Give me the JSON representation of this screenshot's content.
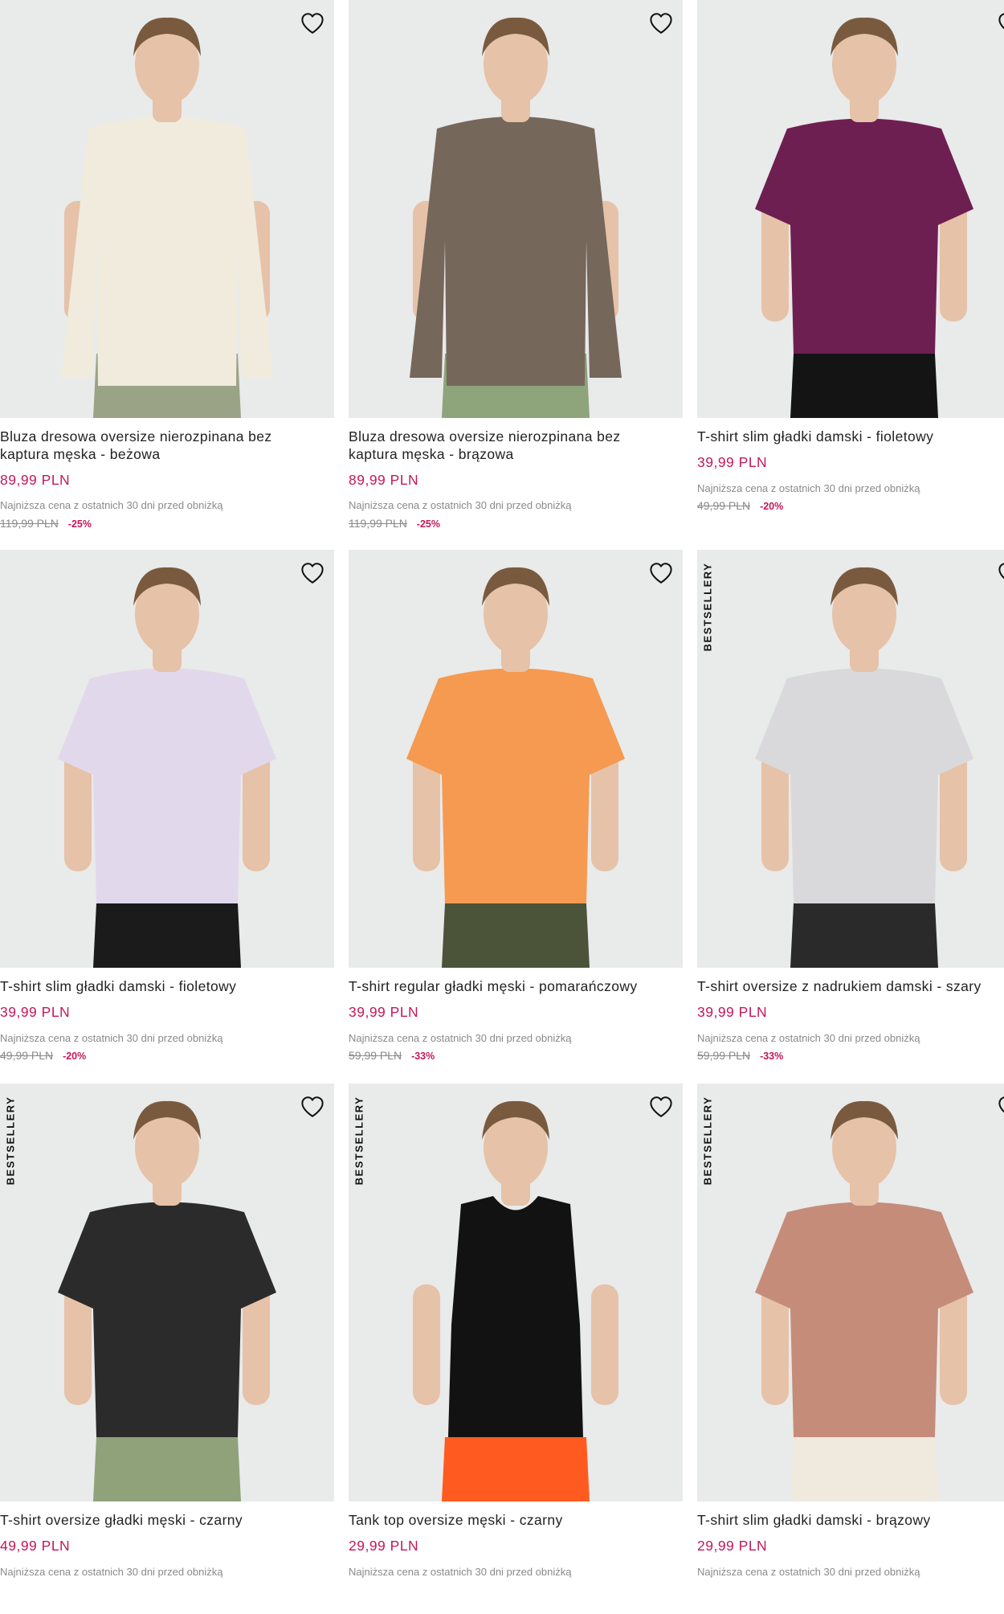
{
  "colors": {
    "accent": "#c2185b",
    "image_bg": "#e9eaea",
    "muted_text": "#8a8a8a"
  },
  "products": [
    {
      "title": "Bluza dresowa oversize nierozpinana bez kaptura męska - beżowa",
      "price": "89,99 PLN",
      "lowest_price_note": "Najniższa cena z ostatnich 30 dni przed obniżką",
      "old_price": "119,99 PLN",
      "discount": "-25%",
      "badge": "",
      "icon": "heart-icon",
      "garment_color": "#f1ebdd",
      "pants_color": "#9aa386"
    },
    {
      "title": "Bluza dresowa oversize nierozpinana bez kaptura męska - brązowa",
      "price": "89,99 PLN",
      "lowest_price_note": "Najniższa cena z ostatnich 30 dni przed obniżką",
      "old_price": "119,99 PLN",
      "discount": "-25%",
      "badge": "",
      "icon": "heart-icon",
      "garment_color": "#76675b",
      "pants_color": "#8ea47b"
    },
    {
      "title": "T-shirt slim gładki damski - fioletowy",
      "price": "39,99 PLN",
      "lowest_price_note": "Najniższa cena z ostatnich 30 dni przed obniżką",
      "old_price": "49,99 PLN",
      "discount": "-20%",
      "badge": "",
      "icon": "heart-icon",
      "garment_color": "#6d1f52",
      "pants_color": "#141414"
    },
    {
      "title": "T-shirt slim gładki damski - fioletowy",
      "price": "39,99 PLN",
      "lowest_price_note": "Najniższa cena z ostatnich 30 dni przed obniżką",
      "old_price": "49,99 PLN",
      "discount": "-20%",
      "badge": "",
      "icon": "heart-icon",
      "garment_color": "#e2d8ec",
      "pants_color": "#1b1b1b"
    },
    {
      "title": "T-shirt regular gładki męski - pomarańczowy",
      "price": "39,99 PLN",
      "lowest_price_note": "Najniższa cena z ostatnich 30 dni przed obniżką",
      "old_price": "59,99 PLN",
      "discount": "-33%",
      "badge": "",
      "icon": "heart-icon",
      "garment_color": "#f59a50",
      "pants_color": "#4b5339"
    },
    {
      "title": "T-shirt oversize z nadrukiem damski - szary",
      "price": "39,99 PLN",
      "lowest_price_note": "Najniższa cena z ostatnich 30 dni przed obniżką",
      "old_price": "59,99 PLN",
      "discount": "-33%",
      "badge": "BESTSELLERY",
      "icon": "heart-icon",
      "garment_color": "#d9d9db",
      "pants_color": "#2a2a2a"
    },
    {
      "title": "T-shirt oversize gładki męski - czarny",
      "price": "49,99 PLN",
      "lowest_price_note": "Najniższa cena z ostatnich 30 dni przed obniżką",
      "old_price": "",
      "discount": "",
      "badge": "BESTSELLERY",
      "icon": "heart-icon",
      "garment_color": "#2b2b2b",
      "pants_color": "#8fa27a"
    },
    {
      "title": "Tank top oversize męski - czarny",
      "price": "29,99 PLN",
      "lowest_price_note": "Najniższa cena z ostatnich 30 dni przed obniżką",
      "old_price": "",
      "discount": "",
      "badge": "BESTSELLERY",
      "icon": "heart-icon",
      "garment_color": "#121212",
      "pants_color": "#ff5a1f"
    },
    {
      "title": "T-shirt slim gładki damski - brązowy",
      "price": "29,99 PLN",
      "lowest_price_note": "Najniższa cena z ostatnich 30 dni przed obniżką",
      "old_price": "",
      "discount": "",
      "badge": "BESTSELLERY",
      "icon": "heart-icon",
      "garment_color": "#c58c7a",
      "pants_color": "#efe9de"
    }
  ]
}
